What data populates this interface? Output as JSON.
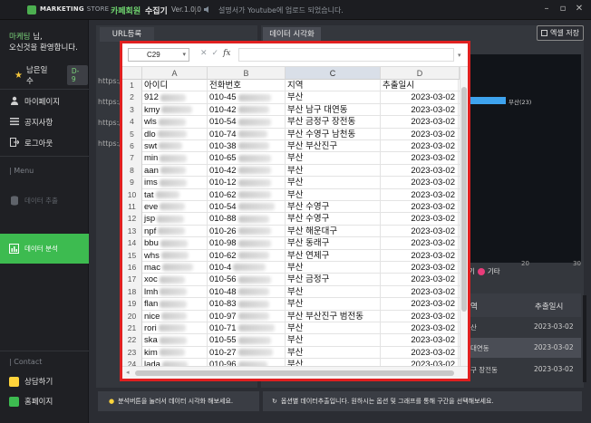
{
  "titlebar": {
    "logo_text": "MARKETING",
    "logo_store": "STORE",
    "app_name": "카페회원",
    "app_sub": "수집기",
    "version": "Ver.1.0.0",
    "notice": "설명서가 Youtube에 업로드 되었습니다.",
    "controls": [
      "–",
      "▫",
      "✕"
    ]
  },
  "sidebar": {
    "user_name": "마케팅",
    "user_suffix": " 님,",
    "welcome": "오신것을 환영합니다.",
    "days_label": "남은일수",
    "days_value": "D-9",
    "nav": [
      {
        "label": "마이페이지",
        "icon": "user-icon"
      },
      {
        "label": "공지사항",
        "icon": "list-icon"
      },
      {
        "label": "로그아웃",
        "icon": "logout-icon"
      }
    ],
    "menu_header": "| Menu",
    "menu_items": [
      {
        "label": "데이터 추출",
        "icon": "database-icon",
        "active": false
      },
      {
        "label": "데이터 분석",
        "icon": "chart-icon",
        "active": true
      }
    ],
    "contact_header": "| Contact",
    "contact_items": [
      {
        "label": "상담하기",
        "icon": "chat-icon"
      },
      {
        "label": "홈페이지",
        "icon": "home-icon"
      }
    ]
  },
  "main": {
    "tab_url": "URL등록",
    "tab_viz": "데이터 시각화",
    "excel_button": "엑셀 저장",
    "url_rows": [
      "https://",
      "https://",
      "https://",
      "https://"
    ],
    "chart": {
      "bar_label": "부산(23)",
      "axis_ticks": [
        "20",
        "30"
      ],
      "legend_prefix": "기",
      "legend_item": "기타"
    },
    "table": {
      "headers": [
        "역",
        "추출일시"
      ],
      "rows": [
        {
          "region": "산",
          "date": "2023-03-02"
        },
        {
          "region": "대연동",
          "date": "2023-03-02"
        },
        {
          "region": "구 장전동",
          "date": "2023-03-02"
        }
      ]
    },
    "hint_left": "분석버튼을 눌러서 데이터 시각화 해보세요.",
    "hint_right": "옵션별 데이터추출입니다. 원하시는 옵션 및 그래프를 통해 구간을 선택해보세요."
  },
  "excel": {
    "cell_ref": "C29",
    "fx": "fx",
    "columns": [
      "A",
      "B",
      "C",
      "D"
    ],
    "header_row": [
      "아이디",
      "전화번호",
      "지역",
      "추출일시"
    ],
    "rows": [
      {
        "n": "2",
        "id": "912",
        "phone": "010-45",
        "region": "부산",
        "date": "2023-03-02"
      },
      {
        "n": "3",
        "id": "kmy",
        "phone": "010-42",
        "region": "부산 남구 대연동",
        "date": "2023-03-02"
      },
      {
        "n": "4",
        "id": "wls",
        "phone": "010-54",
        "region": "부산 금정구 장전동",
        "date": "2023-03-02"
      },
      {
        "n": "5",
        "id": "dlo",
        "phone": "010-74",
        "region": "부산 수영구 남천동",
        "date": "2023-03-02"
      },
      {
        "n": "6",
        "id": "swt",
        "phone": "010-38",
        "region": "부산 부산진구",
        "date": "2023-03-02"
      },
      {
        "n": "7",
        "id": "min",
        "phone": "010-65",
        "region": "부산",
        "date": "2023-03-02"
      },
      {
        "n": "8",
        "id": "aan",
        "phone": "010-42",
        "region": "부산",
        "date": "2023-03-02"
      },
      {
        "n": "9",
        "id": "ims",
        "phone": "010-12",
        "region": "부산",
        "date": "2023-03-02"
      },
      {
        "n": "10",
        "id": "tat",
        "phone": "010-62",
        "region": "부산",
        "date": "2023-03-02"
      },
      {
        "n": "11",
        "id": "eve",
        "phone": "010-54",
        "region": "부산 수영구",
        "date": "2023-03-02"
      },
      {
        "n": "12",
        "id": "jsp",
        "phone": "010-88",
        "region": "부산 수영구",
        "date": "2023-03-02"
      },
      {
        "n": "13",
        "id": "npf",
        "phone": "010-26",
        "region": "부산 해운대구",
        "date": "2023-03-02"
      },
      {
        "n": "14",
        "id": "bbu",
        "phone": "010-98",
        "region": "부산 동래구",
        "date": "2023-03-02"
      },
      {
        "n": "15",
        "id": "whs",
        "phone": "010-62",
        "region": "부산 연제구",
        "date": "2023-03-02"
      },
      {
        "n": "16",
        "id": "mac",
        "phone": "010-4",
        "region": "부산",
        "date": "2023-03-02"
      },
      {
        "n": "17",
        "id": "xoc",
        "phone": "010-56",
        "region": "부산 금정구",
        "date": "2023-03-02"
      },
      {
        "n": "18",
        "id": "lmh",
        "phone": "010-48",
        "region": "부산",
        "date": "2023-03-02"
      },
      {
        "n": "19",
        "id": "flan",
        "phone": "010-83",
        "region": "부산",
        "date": "2023-03-02"
      },
      {
        "n": "20",
        "id": "nice",
        "phone": "010-97",
        "region": "부산 부산진구 범전동",
        "date": "2023-03-02"
      },
      {
        "n": "21",
        "id": "rori",
        "phone": "010-71",
        "region": "부산",
        "date": "2023-03-02"
      },
      {
        "n": "22",
        "id": "ska",
        "phone": "010-55",
        "region": "부산",
        "date": "2023-03-02"
      },
      {
        "n": "23",
        "id": "kim",
        "phone": "010-27",
        "region": "부산",
        "date": "2023-03-02"
      },
      {
        "n": "24",
        "id": "lada",
        "phone": "010-96",
        "region": "부산",
        "date": "2023-03-02"
      }
    ]
  }
}
